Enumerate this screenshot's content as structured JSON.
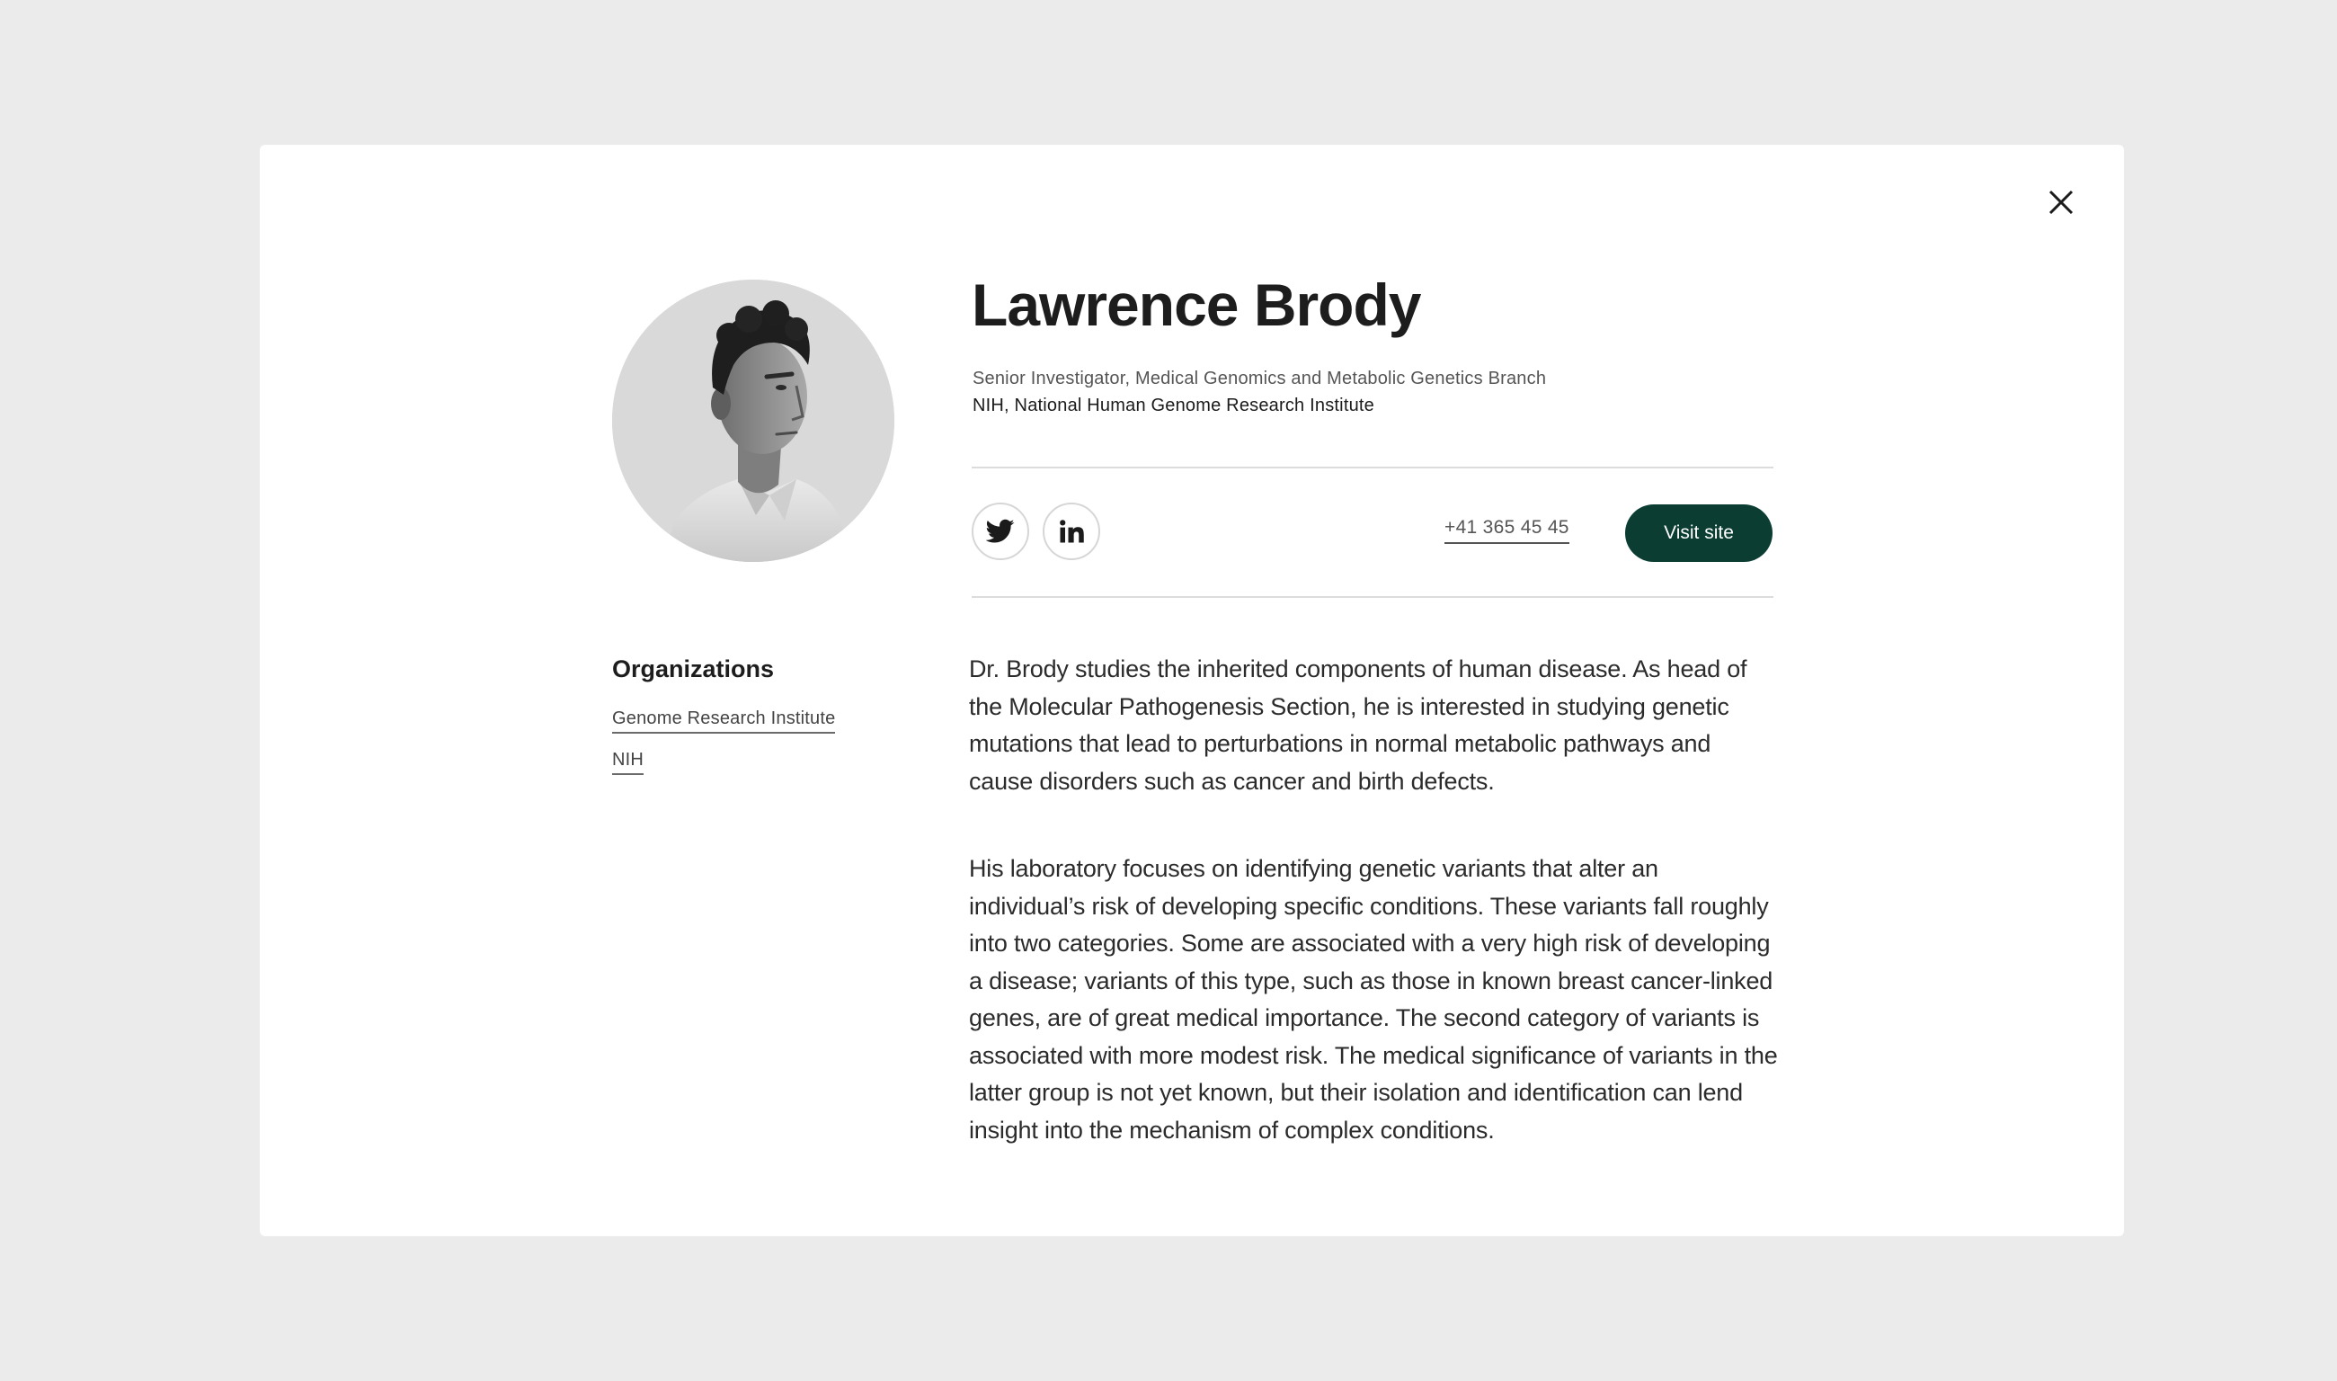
{
  "profile": {
    "name": "Lawrence Brody",
    "role": "Senior Investigator, Medical Genomics and Metabolic Genetics Branch",
    "institute": "NIH, National Human Genome Research Institute",
    "avatar_alt": "portrait-photo"
  },
  "contact": {
    "phone": "+41 365 45 45",
    "visit_label": "Visit site",
    "twitter_icon": "twitter-icon",
    "linkedin_icon": "linkedin-icon"
  },
  "organizations": {
    "heading": "Organizations",
    "items": [
      "Genome Research Institute",
      "NIH"
    ]
  },
  "bio": {
    "paragraphs": [
      "Dr. Brody studies the inherited components of human disease. As head of the Molecular Pathogenesis Section, he is interested in studying genetic mutations that lead to perturbations in normal metabolic pathways and cause disorders such as cancer and birth defects.",
      "His laboratory focuses on identifying genetic variants that alter an individual’s risk of developing specific conditions. These variants fall roughly into two categories. Some are associated with a very high risk of developing a disease; variants of this type, such as those in known breast cancer-linked genes, are of great medical importance. The second category of variants is associated with more modest risk. The medical significance of variants in the latter group is not yet known, but their isolation and identification can lend insight into the mechanism of complex conditions."
    ]
  },
  "colors": {
    "page_background": "#ebebeb",
    "modal_background": "#ffffff",
    "accent_button": "#0b3d33"
  }
}
